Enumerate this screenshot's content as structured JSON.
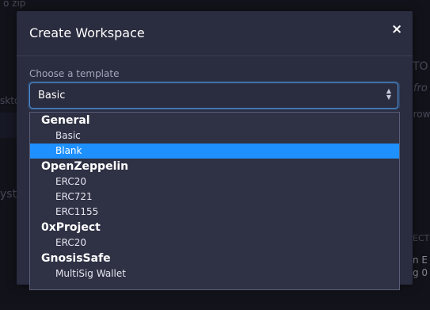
{
  "background": {
    "texts": [
      "o zip",
      "skto",
      "yste",
      "TO",
      "fro",
      "grow",
      "ECT",
      "n E",
      "g 0"
    ]
  },
  "modal": {
    "title": "Create Workspace",
    "close_label": "×",
    "field_label": "Choose a template",
    "selected_value": "Basic"
  },
  "dropdown": {
    "groups": [
      {
        "label": "General",
        "options": [
          "Basic",
          "Blank"
        ]
      },
      {
        "label": "OpenZeppelin",
        "options": [
          "ERC20",
          "ERC721",
          "ERC1155"
        ]
      },
      {
        "label": "0xProject",
        "options": [
          "ERC20"
        ]
      },
      {
        "label": "GnosisSafe",
        "options": [
          "MultiSig Wallet"
        ]
      }
    ],
    "highlighted": "Blank"
  },
  "colors": {
    "modal_bg": "#2a2c3f",
    "accent": "#1e90ff",
    "focus_border": "#4a90d9"
  }
}
